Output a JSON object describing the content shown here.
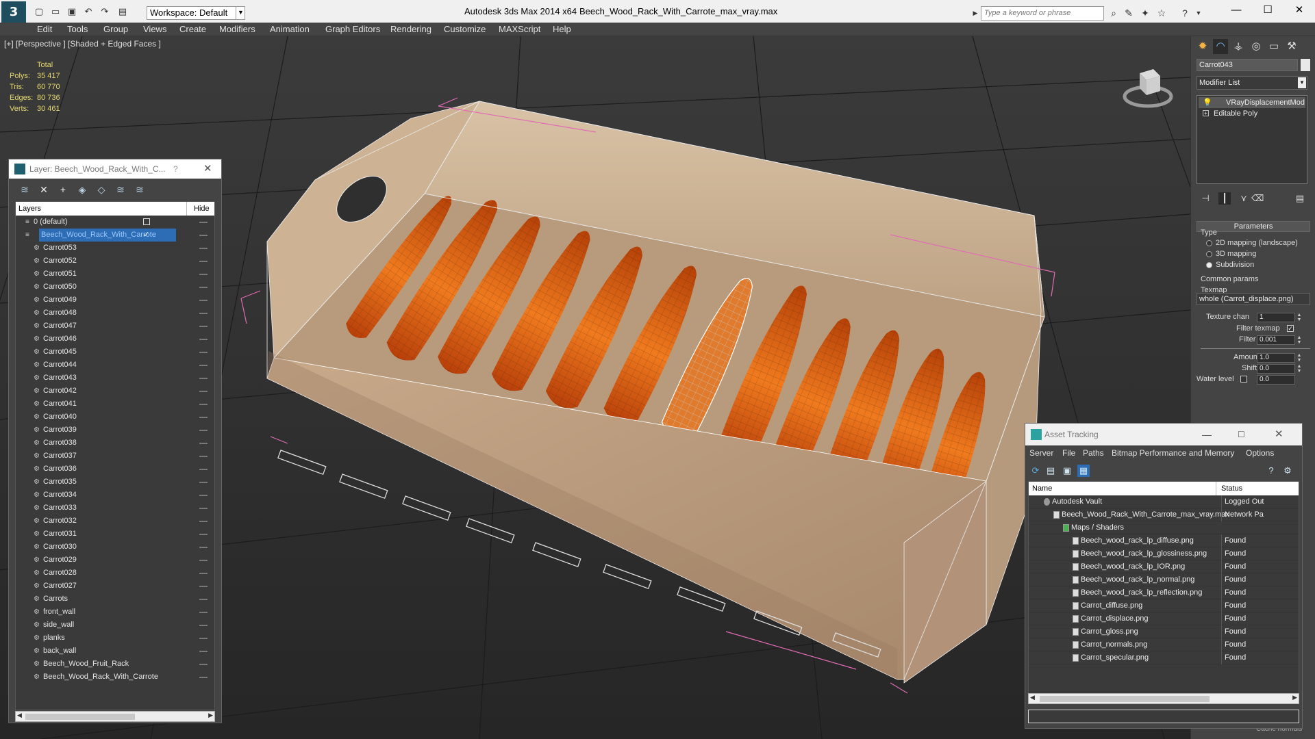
{
  "titlebar": {
    "workspace": "Workspace: Default",
    "app_title": "Autodesk 3ds Max  2014 x64",
    "file_title": "Beech_Wood_Rack_With_Carrote_max_vray.max",
    "search_placeholder": "Type a keyword or phrase"
  },
  "menu": [
    "Edit",
    "Tools",
    "Group",
    "Views",
    "Create",
    "Modifiers",
    "Animation",
    "Graph Editors",
    "Rendering",
    "Customize",
    "MAXScript",
    "Help"
  ],
  "viewport": {
    "label": "[+] [Perspective ] [Shaded + Edged Faces ]",
    "stats": {
      "header": "Total",
      "rows": [
        {
          "k": "Polys:",
          "v": "35 417"
        },
        {
          "k": "Tris:",
          "v": "60 770"
        },
        {
          "k": "Edges:",
          "v": "80 736"
        },
        {
          "k": "Verts:",
          "v": "30 461"
        }
      ]
    }
  },
  "layer_dialog": {
    "title": "Layer: Beech_Wood_Rack_With_C...",
    "help": "?",
    "col_layers": "Layers",
    "col_hide": "Hide",
    "rows": [
      {
        "name": "0 (default)",
        "level": 0,
        "type": "layer"
      },
      {
        "name": "Beech_Wood_Rack_With_Carrote",
        "level": 0,
        "type": "layer",
        "selected": true
      },
      {
        "name": "Carrot053",
        "level": 1
      },
      {
        "name": "Carrot052",
        "level": 1
      },
      {
        "name": "Carrot051",
        "level": 1
      },
      {
        "name": "Carrot050",
        "level": 1
      },
      {
        "name": "Carrot049",
        "level": 1
      },
      {
        "name": "Carrot048",
        "level": 1
      },
      {
        "name": "Carrot047",
        "level": 1
      },
      {
        "name": "Carrot046",
        "level": 1
      },
      {
        "name": "Carrot045",
        "level": 1
      },
      {
        "name": "Carrot044",
        "level": 1
      },
      {
        "name": "Carrot043",
        "level": 1
      },
      {
        "name": "Carrot042",
        "level": 1
      },
      {
        "name": "Carrot041",
        "level": 1
      },
      {
        "name": "Carrot040",
        "level": 1
      },
      {
        "name": "Carrot039",
        "level": 1
      },
      {
        "name": "Carrot038",
        "level": 1
      },
      {
        "name": "Carrot037",
        "level": 1
      },
      {
        "name": "Carrot036",
        "level": 1
      },
      {
        "name": "Carrot035",
        "level": 1
      },
      {
        "name": "Carrot034",
        "level": 1
      },
      {
        "name": "Carrot033",
        "level": 1
      },
      {
        "name": "Carrot032",
        "level": 1
      },
      {
        "name": "Carrot031",
        "level": 1
      },
      {
        "name": "Carrot030",
        "level": 1
      },
      {
        "name": "Carrot029",
        "level": 1
      },
      {
        "name": "Carrot028",
        "level": 1
      },
      {
        "name": "Carrot027",
        "level": 1
      },
      {
        "name": "Carrots",
        "level": 1
      },
      {
        "name": "front_wall",
        "level": 1
      },
      {
        "name": "side_wall",
        "level": 1
      },
      {
        "name": "planks",
        "level": 1
      },
      {
        "name": "back_wall",
        "level": 1
      },
      {
        "name": "Beech_Wood_Fruit_Rack",
        "level": 1
      },
      {
        "name": "Beech_Wood_Rack_With_Carrote",
        "level": 1
      }
    ]
  },
  "command_panel": {
    "object_name": "Carrot043",
    "modifier_list": "Modifier List",
    "stack": [
      "VRayDisplacementMod",
      "Editable Poly"
    ],
    "parameters": "Parameters",
    "type_label": "Type",
    "type_options": [
      {
        "label": "2D mapping (landscape)",
        "on": false
      },
      {
        "label": "3D mapping",
        "on": false
      },
      {
        "label": "Subdivision",
        "on": true
      }
    ],
    "common_params": "Common params",
    "texmap_label": "Texmap",
    "texmap_value": "whole (Carrot_displace.png)",
    "texture_chan_label": "Texture chan",
    "texture_chan_value": "1",
    "filter_texmap_label": "Filter texmap",
    "filter_blur_label": "Filter blur",
    "filter_blur_value": "0.001",
    "amount_label": "Amount",
    "amount_value": "1.0",
    "shift_label": "Shift",
    "shift_value": "0.0",
    "water_level_label": "Water level",
    "water_level_value": "0.0",
    "cache_normals": "Cache normals"
  },
  "asset_tracking": {
    "title": "Asset Tracking",
    "menu": [
      "Server",
      "File",
      "Paths",
      "Bitmap Performance and Memory",
      "Options"
    ],
    "col_name": "Name",
    "col_status": "Status",
    "rows": [
      {
        "name": "Autodesk Vault",
        "status": "Logged Out",
        "level": 0
      },
      {
        "name": "Beech_Wood_Rack_With_Carrote_max_vray.max",
        "status": "Network Pa",
        "level": 1
      },
      {
        "name": "Maps / Shaders",
        "status": "",
        "level": 2
      },
      {
        "name": "Beech_wood_rack_lp_diffuse.png",
        "status": "Found",
        "level": 3
      },
      {
        "name": "Beech_wood_rack_lp_glossiness.png",
        "status": "Found",
        "level": 3
      },
      {
        "name": "Beech_wood_rack_lp_IOR.png",
        "status": "Found",
        "level": 3
      },
      {
        "name": "Beech_wood_rack_lp_normal.png",
        "status": "Found",
        "level": 3
      },
      {
        "name": "Beech_wood_rack_lp_reflection.png",
        "status": "Found",
        "level": 3
      },
      {
        "name": "Carrot_diffuse.png",
        "status": "Found",
        "level": 3
      },
      {
        "name": "Carrot_displace.png",
        "status": "Found",
        "level": 3
      },
      {
        "name": "Carrot_gloss.png",
        "status": "Found",
        "level": 3
      },
      {
        "name": "Carrot_normals.png",
        "status": "Found",
        "level": 3
      },
      {
        "name": "Carrot_specular.png",
        "status": "Found",
        "level": 3
      }
    ]
  }
}
